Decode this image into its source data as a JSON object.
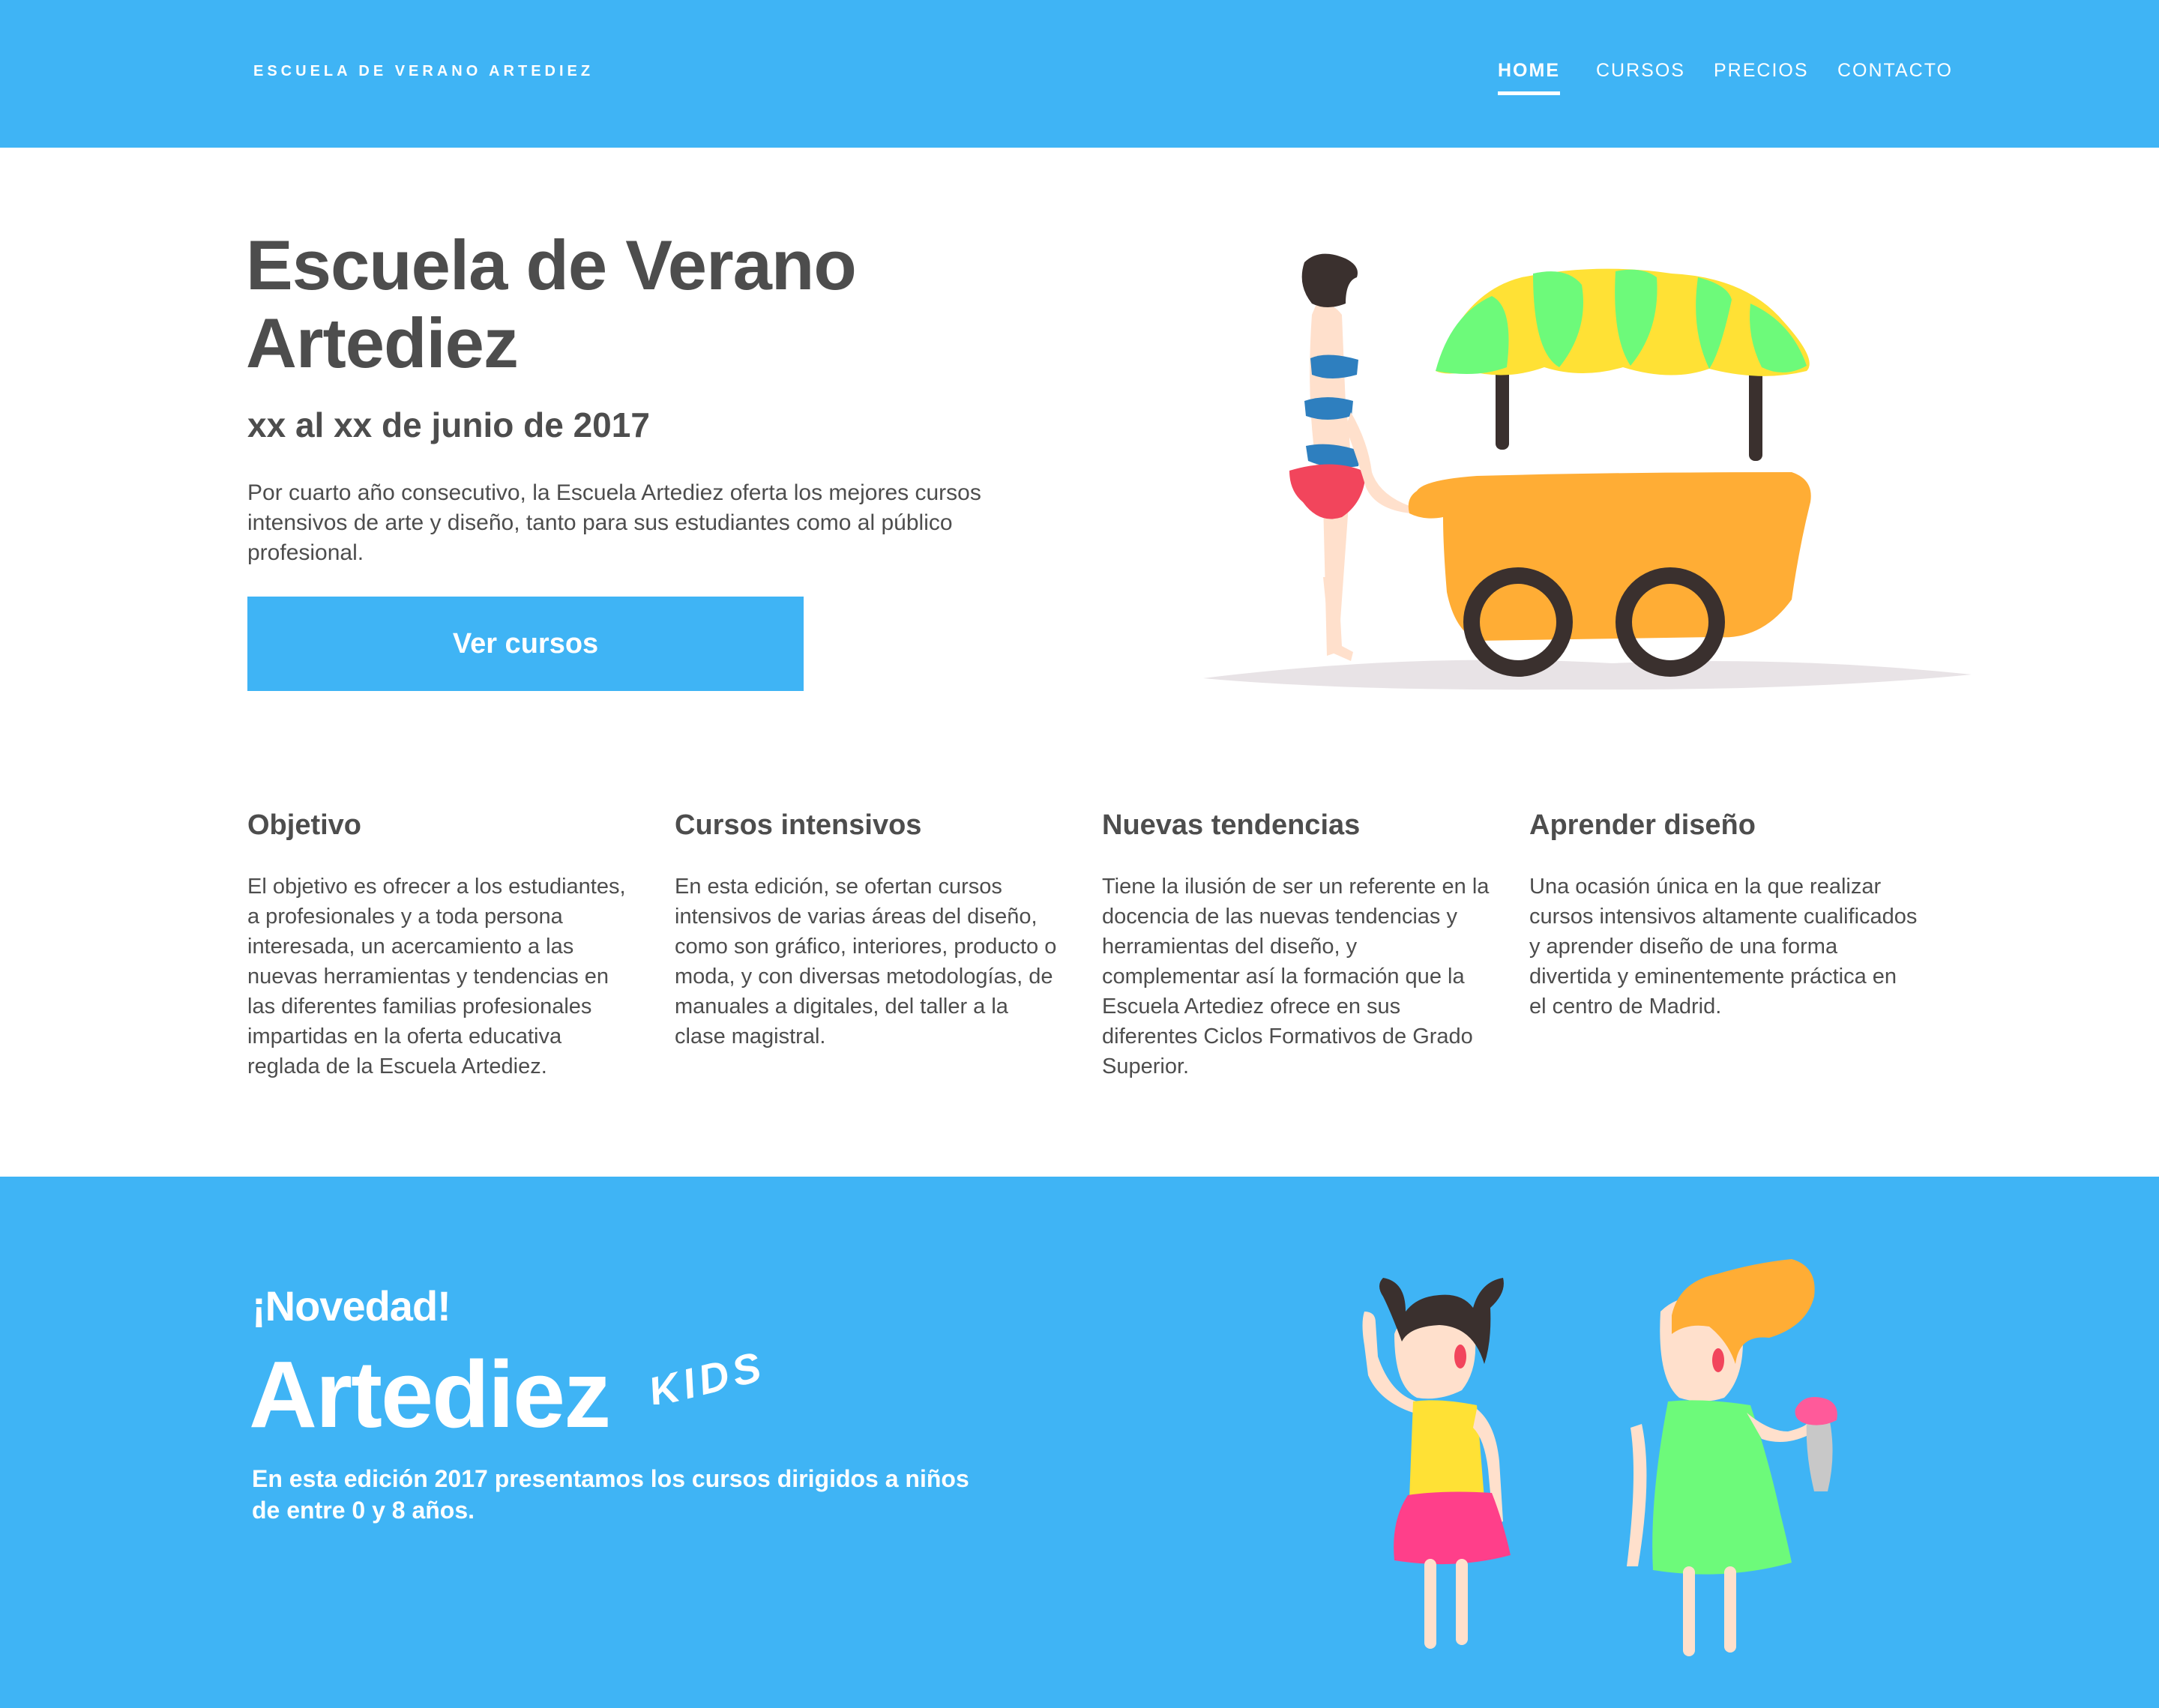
{
  "header": {
    "brand": "ESCUELA DE VERANO ARTEDIEZ",
    "nav": [
      {
        "label": "HOME",
        "active": true
      },
      {
        "label": "CURSOS",
        "active": false
      },
      {
        "label": "PRECIOS",
        "active": false
      },
      {
        "label": "CONTACTO",
        "active": false
      }
    ]
  },
  "hero": {
    "title_line1": "Escuela de Verano",
    "title_line2": "Artediez",
    "dates": "xx al xx de junio de 2017",
    "intro": "Por cuarto año consecutivo, la Escuela Artediez oferta los mejores cursos intensivos de arte y diseño, tanto para sus estudiantes como al público profesional.",
    "cta_label": "Ver cursos",
    "illustration": "ice-cream-cart-illustration"
  },
  "features": [
    {
      "title": "Objetivo",
      "text": "El objetivo es ofrecer a los estudiantes, a profesionales y a toda persona interesada, un acercamiento a las nuevas herramientas y tendencias en las diferentes familias profesionales impartidas en la oferta educativa reglada de la Escuela Artediez."
    },
    {
      "title": "Cursos intensivos",
      "text": "En esta edición, se ofertan cursos intensivos de varias áreas del diseño, como son gráfico, interiores, producto o moda, y con diversas metodologías, de manuales a digitales, del taller a la clase magistral."
    },
    {
      "title": "Nuevas tendencias",
      "text": "Tiene la ilusión de ser un referente en la docencia de las nuevas tendencias y herramientas del diseño, y complementar así la formación que la Escuela Artediez ofrece en sus diferentes Ciclos Formativos de Grado Superior."
    },
    {
      "title": "Aprender diseño",
      "text": "Una ocasión única en la que realizar cursos intensivos altamente cualificados y aprender diseño de una forma divertida y eminentemente práctica en el centro de Madrid."
    }
  ],
  "kids": {
    "novedad": "¡Novedad!",
    "brand": "Artediez",
    "tag": "KIDS",
    "text": "En esta edición 2017 presentamos los cursos dirigidos a niños de entre 0 y 8 años.",
    "illustration": "kids-illustration"
  },
  "colors": {
    "accent": "#3fb4f5",
    "text": "#4d4d4d",
    "white": "#ffffff"
  }
}
